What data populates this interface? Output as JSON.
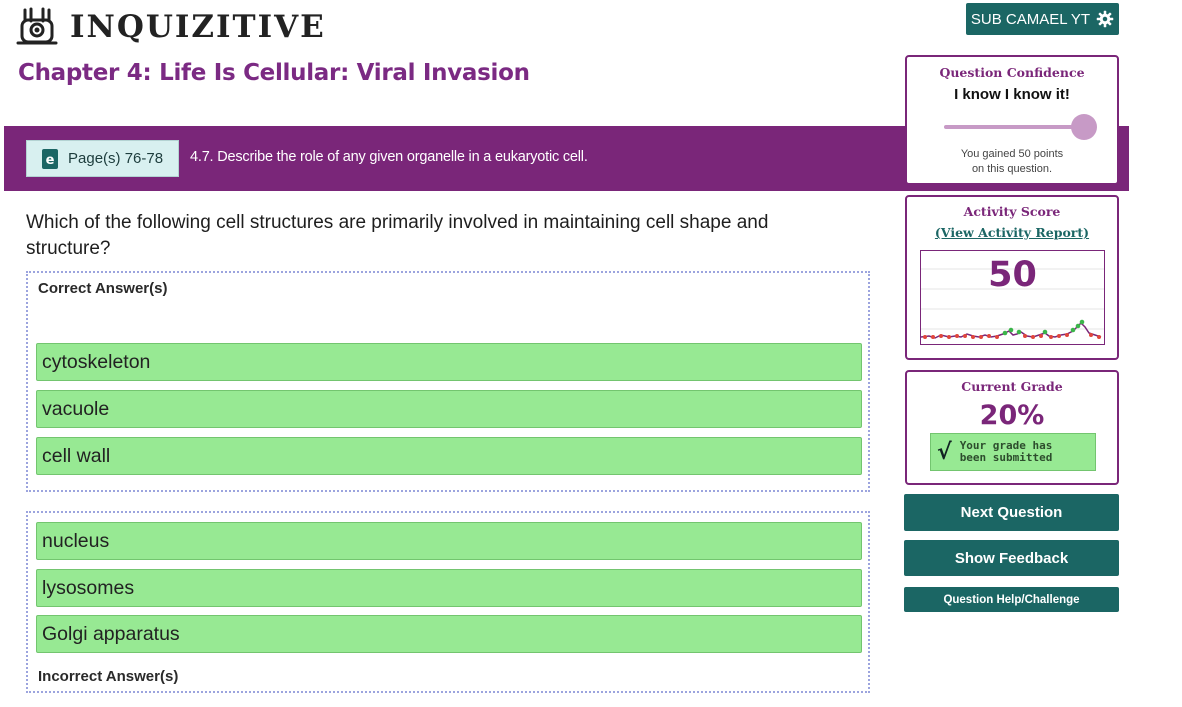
{
  "header": {
    "app_name": "INQUIZITIVE",
    "user_button_label": "SUB CAMAEL YT"
  },
  "chapter": {
    "title": "Chapter 4: Life Is Cellular: Viral Invasion"
  },
  "objective_bar": {
    "pages_label": "Page(s) 76-78",
    "objective_text": "4.7. Describe the role of any given organelle in a eukaryotic cell."
  },
  "question": {
    "text": "Which of the following cell structures are primarily involved in maintaining cell shape and structure?",
    "correct_label": "Correct Answer(s)",
    "incorrect_label": "Incorrect Answer(s)",
    "correct_answers": [
      "cytoskeleton",
      "vacuole",
      "cell wall"
    ],
    "incorrect_answers": [
      "nucleus",
      "lysosomes",
      "Golgi apparatus"
    ]
  },
  "confidence": {
    "title": "Question Confidence",
    "value": "I know I know it!",
    "slider_level": 1.0,
    "gained_line1": "You gained 50 points",
    "gained_line2": "on this question."
  },
  "activity": {
    "title": "Activity Score",
    "report_link": "(View Activity Report)",
    "score": "50"
  },
  "grade": {
    "title": "Current Grade",
    "value": "20%",
    "status_line1": "Your grade has",
    "status_line2": "been submitted"
  },
  "actions": {
    "next": "Next Question",
    "feedback": "Show Feedback",
    "help": "Question Help/Challenge"
  },
  "colors": {
    "brand_purple": "#7a2679",
    "teal": "#1b6664",
    "answer_green": "#97e993"
  },
  "icons": {
    "logo": "inquizitive-logo-icon",
    "settings": "gear-icon",
    "ebook": "ebook-icon",
    "check": "checkmark-icon"
  }
}
